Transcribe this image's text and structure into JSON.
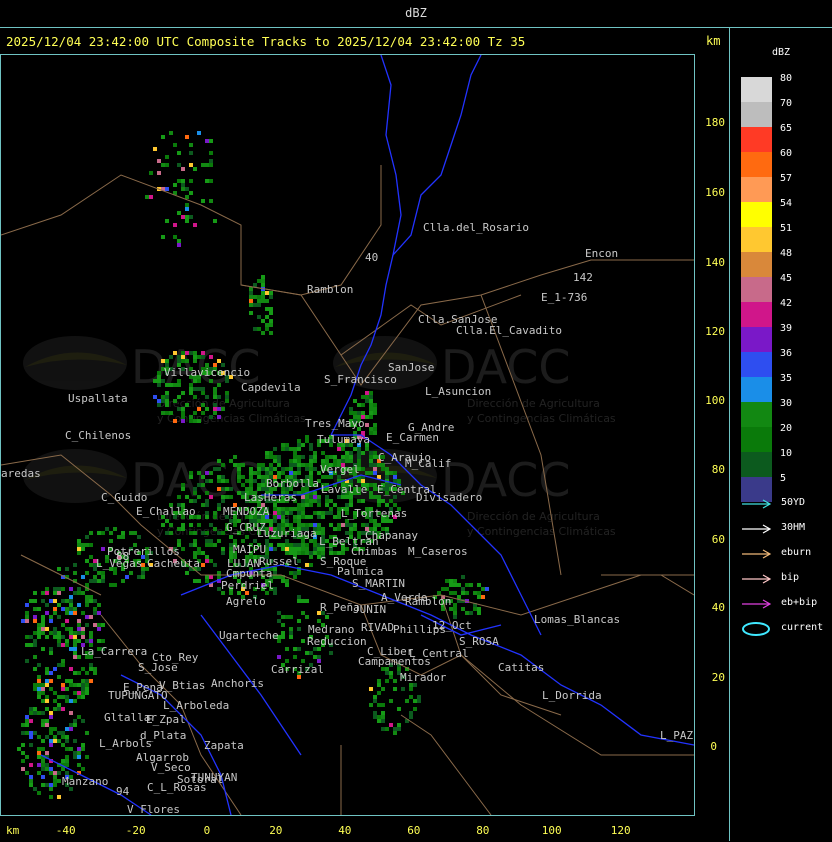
{
  "header": {
    "title": "dBZ"
  },
  "tracks_title": "2025/12/04 23:42:00 UTC Composite Tracks to 2025/12/04 23:42:00 Tz 35",
  "km_top": "km",
  "km_bottom": "km",
  "y_ticks": [
    "180",
    "160",
    "140",
    "120",
    "100",
    "80",
    "60",
    "40",
    "20",
    "0"
  ],
  "x_ticks": [
    "-40",
    "-20",
    "0",
    "20",
    "40",
    "60",
    "80",
    "100",
    "120"
  ],
  "legend": {
    "title": "dBZ",
    "levels": [
      {
        "label": "80",
        "color": "#d8d8d8"
      },
      {
        "label": "70",
        "color": "#bdbdbd"
      },
      {
        "label": "65",
        "color": "#ff3a25"
      },
      {
        "label": "60",
        "color": "#ff6a10"
      },
      {
        "label": "57",
        "color": "#ff9a55"
      },
      {
        "label": "54",
        "color": "#ffff00"
      },
      {
        "label": "51",
        "color": "#ffc830"
      },
      {
        "label": "48",
        "color": "#d9883a"
      },
      {
        "label": "45",
        "color": "#c86a8a"
      },
      {
        "label": "42",
        "color": "#d0168a"
      },
      {
        "label": "39",
        "color": "#7a18c8"
      },
      {
        "label": "36",
        "color": "#2e4ef0"
      },
      {
        "label": "35",
        "color": "#1a8ee8"
      },
      {
        "label": "30",
        "color": "#128812"
      },
      {
        "label": "20",
        "color": "#0a7a0a"
      },
      {
        "label": "10",
        "color": "#0c5a1e"
      },
      {
        "label": "5",
        "color": "#3a3a8a"
      }
    ]
  },
  "tracks_legend": [
    {
      "label": "50YD",
      "color": "#40e0e0",
      "kind": "arrow"
    },
    {
      "label": "30HM",
      "color": "#ffffff",
      "kind": "arrow"
    },
    {
      "label": "eburn",
      "color": "#f0b878",
      "kind": "arrow"
    },
    {
      "label": "bip",
      "color": "#ffc8c8",
      "kind": "arrow"
    },
    {
      "label": "eb+bip",
      "color": "#e040e0",
      "kind": "arrow"
    },
    {
      "label": "current",
      "color": "#40e8ff",
      "kind": "ellipse"
    }
  ],
  "watermarks": [
    {
      "brand": "DACC",
      "line1": "Dirección de Agricultura",
      "line2": "y Contingencias Climáticas"
    },
    {
      "brand": "DACC",
      "line1": "Dirección de Agricultura",
      "line2": "y Contingencias Climáticas"
    },
    {
      "brand": "DACC",
      "line1": "Dirección de Agricultura",
      "line2": "y Contingencias Climáticas"
    },
    {
      "brand": "DACC",
      "line1": "Dirección de Agricultura",
      "line2": "y Contingencias Climáticas"
    }
  ],
  "places": [
    "Clla.del_Rosario",
    "Encon",
    "142",
    "E_1-736",
    "Ramblon",
    "Clla.SanJose",
    "Clla.El_Cavadito",
    "Villavicencio",
    "Uspallata",
    "Capdevila",
    "S_Francisco",
    "SanJose",
    "L_Asuncion",
    "C_Chilenos",
    "Tres_Mayo",
    "Tulumaya",
    "E_Carmen",
    "G_Andre",
    "C_Araujo",
    "M_Calif",
    "aredas",
    "Borbolla",
    "Vergel",
    "Lavalle",
    "E_Central",
    "Divisadero",
    "C_Guido",
    "LasHeras",
    "MENDOZA",
    "E_Challao",
    "G_CRUZ",
    "Luzuriaga",
    "L_Tortenas",
    "Chapanay",
    "L_Beltran",
    "Chimbas",
    "M_Caseros",
    "Potrerillos",
    "MAIPU",
    "L_Vegas",
    "Cacheuta",
    "Russel",
    "S_Roque",
    "Palmica",
    "LUJAN",
    "Cmpunta",
    "S_MARTIN",
    "Perdriel",
    "A_Verde",
    "Ramblon",
    "Agrelo",
    "R_Peña",
    "JUNIN",
    "Lomas_Blancas",
    "Ugarteche",
    "12_Oct",
    "RIVAD",
    "Phillips",
    "Medrano",
    "Reduccion",
    "S_ROSA",
    "La_Carrera",
    "Cto_Rey",
    "S_Jose",
    "C_Liber",
    "Campamentos",
    "L_Central",
    "Catitas",
    "Carrizal",
    "Mirador",
    "E_Pena",
    "V_Btias",
    "Anchoris",
    "TUPUNGATO",
    "L_Dorrida",
    "L_Arboleda",
    "Gltallar",
    "E_Zpal",
    "L_PAZ",
    "d_Plata",
    "L_Arbols",
    "Zapata",
    "Algarrob",
    "V_Seco",
    "Sotoral",
    "TUNUYAN",
    "Manzano",
    "C_L_Rosas",
    "94",
    "V_Flores",
    "40",
    "88"
  ]
}
